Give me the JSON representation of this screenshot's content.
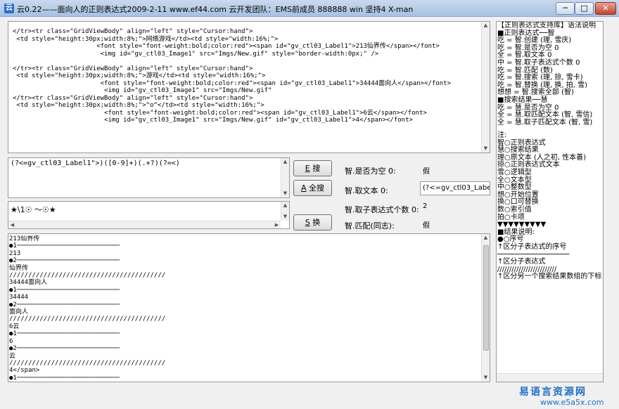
{
  "window": {
    "title": "云0.22——面向人的正则表达式2009-2-11    www.ef44.com 云开发团队：EMS前成员 888888  win 坚持4 X-man",
    "min": "─",
    "max": "□",
    "close": "✕",
    "icon": "云"
  },
  "source_lines": [
    "</tr><tr class=\"GridViewBody\" align=\"left\" style=\"Cursor:hand\">",
    " <td style=\"height:30px;width:8%;\">网络游戏</td><td style=\"width:16%;\">",
    "                      <font style=\"font-weight:bold;color:red\"><span id=\"gv_ctl03_Label1\">213仙界传</span></font>",
    "                       <img id=\"gv_ctl03_Image1\" src=\"Imgs/New.gif\" style=\"border-width:0px;\" />",
    "",
    "</tr><tr class=\"GridViewBody\" align=\"left\" style=\"Cursor:hand\">",
    " <td style=\"height:30px;width:8%;\">游戏</td><td style=\"width:16%;\">",
    "                       <font style=\"font-weight:bold;color:red\"><span id=\"gv_ctl03_Label1\">34444面向人</span></font>",
    "                        <img id=\"gv_ctl03_Image1\" src=\"Imgs/New.gif\"",
    "</tr><tr class=\"GridViewBody\" align=\"left\" style=\"Cursor:hand\">",
    " <td style=\"height:30px;width:8%;\">^o^</td><td style=\"width:16%;\">",
    "                        <font style=\"font-weight:bold;color:red\"><span id=\"gv_ctl03_Label1\">6云</span></font>",
    "                        <img id=\"gv_ctl03_Image1\" src=\"Imgs/New.gif\" id=\"gv_ctl03_Label1\">4</span></font>"
  ],
  "regex_input": "(?<=gv_ctl03_Label1\">)([0-9]+)(.+?)(?=<)",
  "pattern_input": "★\\1☉ ～☉★",
  "buttons": {
    "search_key": "E",
    "search_text": "搜",
    "search_all_key": "A",
    "search_all_text": "全搜",
    "replace_key": "S",
    "replace_text": "换"
  },
  "info": [
    {
      "label": "智.是否为空 0:",
      "value": "假"
    },
    {
      "label": "智.取文本 0:",
      "value": "(?<=gv_ctl03_Label1"
    },
    {
      "label": "智.取子表达式个数 0:",
      "value": "2"
    },
    {
      "label": "智.匹配(同志):",
      "value": "假"
    }
  ],
  "result_lines": [
    "213仙界传",
    "●1───────────────────────────",
    "213",
    "●2───────────────────────────",
    "仙界传",
    "/////////////////////////////////////////",
    "34444面向人",
    "●1───────────────────────────",
    "34444",
    "●2───────────────────────────",
    "面向人",
    "/////////////////////////////////////////",
    "6云",
    "●1───────────────────────────",
    "6",
    "●2───────────────────────────",
    "云",
    "/////////////////////////////////////////",
    "4</span>",
    "●1───────────────────────────"
  ],
  "help_lines": [
    "【正则表达式支持库】语法说明",
    "■正则表达式──智",
    "吃 = 智.创建 (理, 雪庆)",
    "吃 = 智.是否为空 0",
    "全 = 智.取文本 0",
    "中 = 智.取子表达式个数 0",
    "吃 = 智.匹配 (数)",
    "吃 = 智.搜索 (理, 掠, 雪卡)",
    "吃 = 智.替换 (理, 换, 拍, 雪)",
    "想想 = 智.搜索全部 (智)",
    "■搜索结果──慧",
    "吃 = 慧.是否为空 0",
    "全 = 慧.取匹配文本 (智, 雪信)",
    "全 = 慧.取子匹配文本 (智, 雪)",
    "",
    "注:",
    "智○正则表达式",
    "慧○搜索结果",
    "理○原文本 (人之初, 性本善)",
    "掠○正则表达式文本",
    "雪○逻辑型",
    "全○文本型",
    "中○整数型",
    "想○开始位置",
    "换○口可替换",
    "数○索引值",
    "拍○卡项",
    "▼▼▼▼▼▼▼▼▼",
    "■结果说明:",
    "●○序号",
    "↑区分子表达式的序号",
    "─────────────────",
    "↑区分子表达式",
    "/////////////////////////",
    "↑区分另一个搜索结果数组的下标"
  ],
  "watermark": {
    "cn": "易语言资源网",
    "en": "www.e5a5x.com"
  }
}
